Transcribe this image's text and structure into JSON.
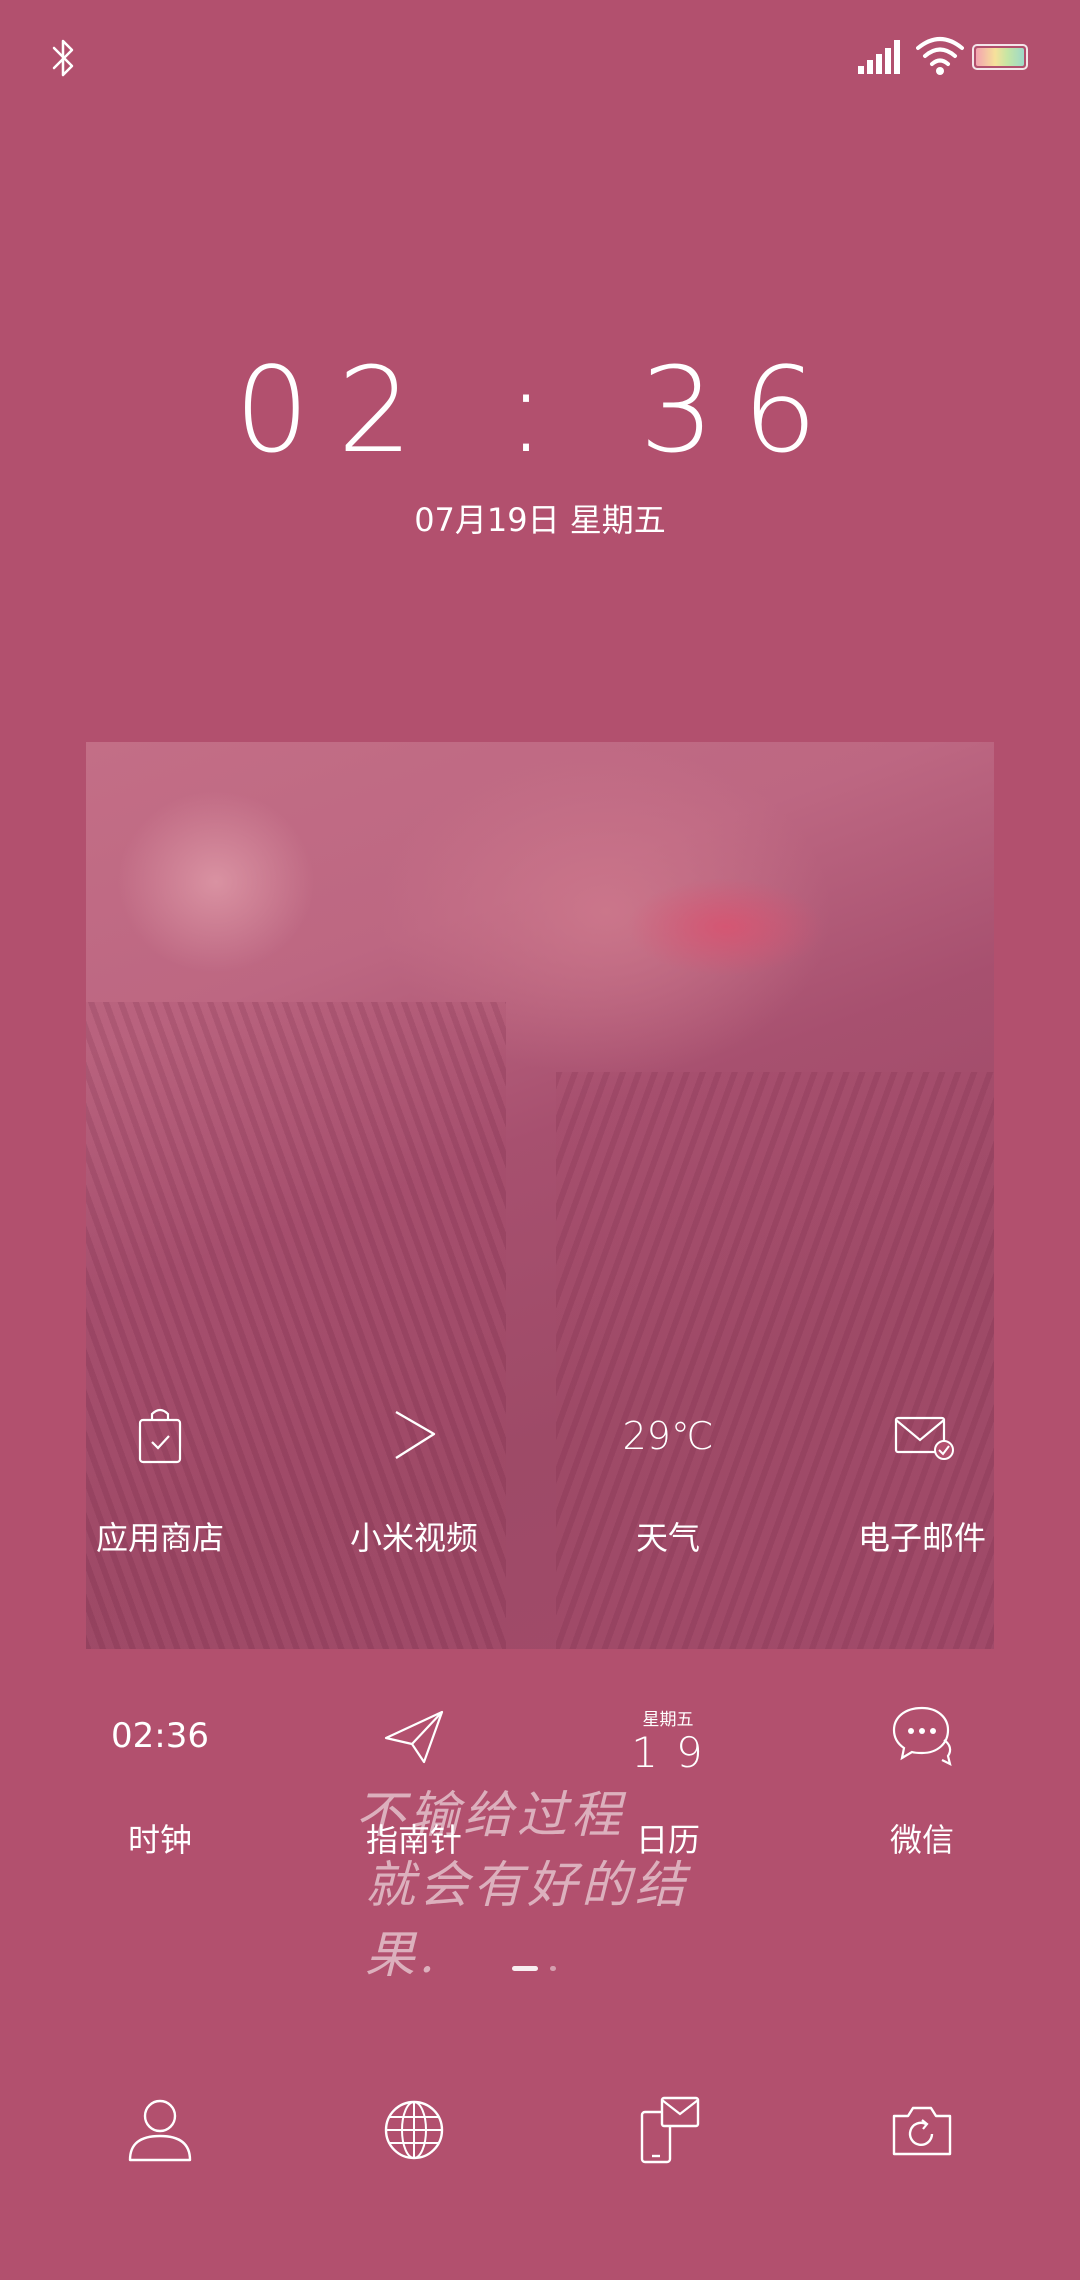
{
  "status_bar": {
    "bluetooth_icon": "bluetooth-icon",
    "signal_icon": "cellular-signal-icon",
    "wifi_icon": "wifi-icon",
    "battery_icon": "battery-icon"
  },
  "lockscreen_clock": {
    "time": "02 : 36",
    "date": "07月19日 星期五"
  },
  "apps_row1": [
    {
      "label": "应用商店",
      "icon": "app-store-bag-icon"
    },
    {
      "label": "小米视频",
      "icon": "play-chevron-icon"
    },
    {
      "label": "天气",
      "icon_text": "29℃"
    },
    {
      "label": "电子邮件",
      "icon": "mail-icon"
    }
  ],
  "apps_row2": [
    {
      "label": "时钟",
      "icon_text": "02:36"
    },
    {
      "label": "指南针",
      "icon": "paper-plane-icon"
    },
    {
      "label": "日历",
      "weekday": "星期五",
      "day": "19"
    },
    {
      "label": "微信",
      "icon": "chat-bubbles-icon"
    }
  ],
  "quote": {
    "line1": "不输给过程",
    "line2": "就会有好的结果."
  },
  "page_indicator": {
    "pages": 2,
    "current": 1
  },
  "dock": [
    {
      "icon": "contacts-person-icon"
    },
    {
      "icon": "browser-globe-icon"
    },
    {
      "icon": "phone-message-icon"
    },
    {
      "icon": "camera-icon"
    }
  ],
  "colors": {
    "background": "#B2506E",
    "foreground": "#FFFFFF"
  }
}
